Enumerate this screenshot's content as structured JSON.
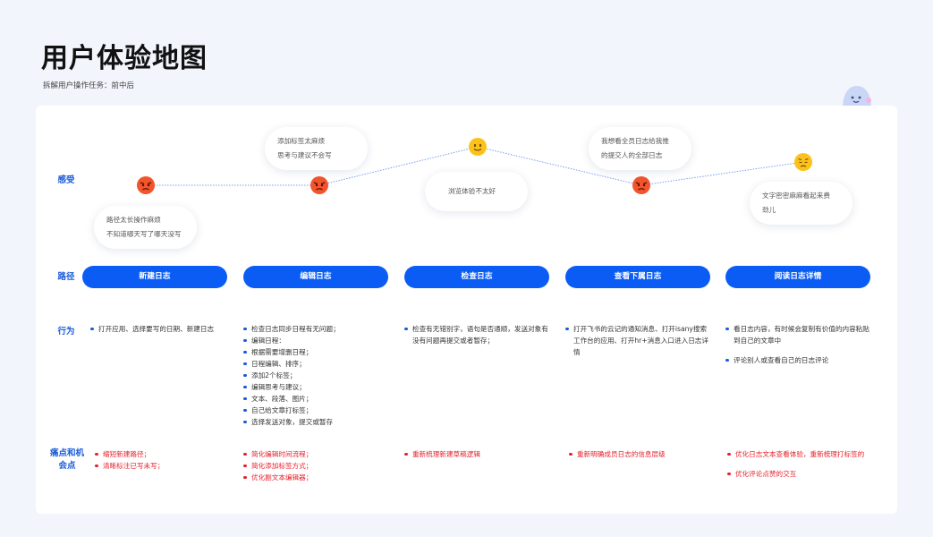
{
  "header": {
    "title": "用户体验地图",
    "subtitle": "拆解用户操作任务：前中后"
  },
  "row_labels": {
    "feeling": "感受",
    "path": "路径",
    "behavior": "行为",
    "pain_line1": "痛点和机",
    "pain_line2": "会点"
  },
  "feelings": [
    {
      "mood": "angry",
      "bubble": [
        "路径太长操作麻烦",
        "不知道哪天写了哪天没写"
      ]
    },
    {
      "mood": "angry",
      "bubble": [
        "添加标签太麻烦",
        "思考与建议不会写"
      ]
    },
    {
      "mood": "happy",
      "bubble": [
        "浏览体验不太好"
      ]
    },
    {
      "mood": "angry",
      "bubble": [
        "我想看全员日志给我推",
        "的提交人的全部日志"
      ]
    },
    {
      "mood": "sad",
      "bubble": [
        "文字密密麻麻看起来费",
        "劲儿"
      ]
    }
  ],
  "stages": [
    {
      "name": "新建日志",
      "behaviors": [
        "打开应用、选择要写的日期、新建日志"
      ],
      "pains": [
        "缩短新建路径；",
        "清晰标注已写未写；"
      ]
    },
    {
      "name": "编辑日志",
      "behaviors": [
        "检查日志同步日程有无问题；",
        "编辑日程：",
        "根据需要增删日程；",
        "日程编辑、排序；",
        "添加2个标签；",
        "编辑思考与建议；",
        "文本、段落、图片；",
        "自己给文章打标签；",
        "选择发送对象，提交或暂存"
      ],
      "pains": [
        "简化编辑时间流程；",
        "简化添加标签方式；",
        "优化副文本编辑器；"
      ]
    },
    {
      "name": "检查日志",
      "behaviors": [
        "检查有无错别字，语句是否通顺，发送对象有没有问题再提交或者暂存；"
      ],
      "pains": [
        "重新梳理新建草稿逻辑"
      ]
    },
    {
      "name": "查看下属日志",
      "behaviors": [
        "打开飞书的云记的通知消息、打开isany搜索工作台的应用、打开hr+消息入口进入日志详情"
      ],
      "pains": [
        "重新明确成员日志的信息层级"
      ]
    },
    {
      "name": "阅读日志详情",
      "behaviors": [
        "看日志内容，有时候会复制有价值的内容粘贴到自己的文章中",
        "评论别人或查看自己的日志评论"
      ],
      "pains": [
        "优化日志文本查看体验，重新梳理打标签的",
        "优化评论点赞的交互"
      ]
    }
  ],
  "colors": {
    "accent": "#0a5cf5",
    "label": "#1a5bd8",
    "pain": "#e5212b",
    "card": "#ffffff",
    "background": "#f2f5fb"
  }
}
